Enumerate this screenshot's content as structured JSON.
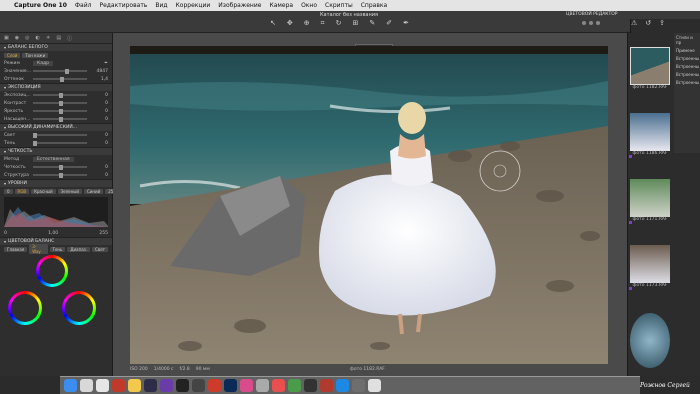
{
  "menubar": {
    "apple": "",
    "app": "Capture One 10",
    "items": [
      "Файл",
      "Редактировать",
      "Вид",
      "Коррекции",
      "Изображение",
      "Камера",
      "Окно",
      "Скрипты",
      "Справка"
    ],
    "time": "Вт 13:05"
  },
  "toolbar": {
    "doc_title": "Каталог без названия",
    "sub_label": "ЦВЕТОВОЙ РЕДАКТОР"
  },
  "left": {
    "sections": {
      "white_balance": "БАЛАНС БЕЛОГО",
      "exposure": "ЭКСПОЗИЦИЯ",
      "hdr": "ВЫСОКИЙ ДИНАМИЧЕСКИЙ...",
      "clarity": "ЧЕТКОСТЬ",
      "levels": "УРОВНИ",
      "color_balance": "ЦВЕТОВОЙ БАЛАНС"
    },
    "wb": {
      "mode_label": "Режим",
      "mode_value": "Кадр",
      "kelvin_label": "Значение...",
      "kelvin_value": "4847",
      "tint_label": "Оттенок",
      "tint_value": "1,4",
      "tabs": [
        "Слой",
        "Тон кожи"
      ]
    },
    "exposure": [
      {
        "label": "Экспозиц...",
        "value": "0"
      },
      {
        "label": "Контраст",
        "value": "0"
      },
      {
        "label": "Яркость",
        "value": "0"
      },
      {
        "label": "Насыщен...",
        "value": "0"
      }
    ],
    "hdr": [
      {
        "label": "Свет",
        "value": "0"
      },
      {
        "label": "Тень",
        "value": "0"
      }
    ],
    "clarity": {
      "method_label": "Метод",
      "method_value": "Естественная",
      "rows": [
        {
          "label": "Четкость",
          "value": "0"
        },
        {
          "label": "Структура",
          "value": "0"
        }
      ]
    },
    "levels": {
      "tabs": [
        "RGB",
        "Красный",
        "Зеленый",
        "Синий"
      ],
      "min": "0",
      "max": "255",
      "bottom_left": "0",
      "bottom_mid": "1,00",
      "bottom_right": "255"
    },
    "color_balance": {
      "tabs": [
        "Главная",
        "3-Way",
        "Тень",
        "Диапаз.",
        "Свет"
      ]
    }
  },
  "center": {
    "top_caption": "Цветопроба",
    "info": {
      "iso": "ISO 200",
      "shutter": "1/4000 с",
      "aperture": "f/2.8",
      "focal": "90 мм",
      "filename": "фото 1182.RAF"
    }
  },
  "right": {
    "panel_items": [
      "Стили и пр",
      "Примене",
      "Встроенны",
      "Встроенны",
      "Встроенны",
      "Встроенны"
    ],
    "thumbs": [
      {
        "caption": "фото 1182.RAF"
      },
      {
        "caption": "фото 1186.RAF"
      },
      {
        "caption": "фото 1171.RAF"
      },
      {
        "caption": "фото 1173.RAF"
      },
      {
        "caption": ""
      }
    ]
  },
  "signature": "Рожнов Сергей"
}
